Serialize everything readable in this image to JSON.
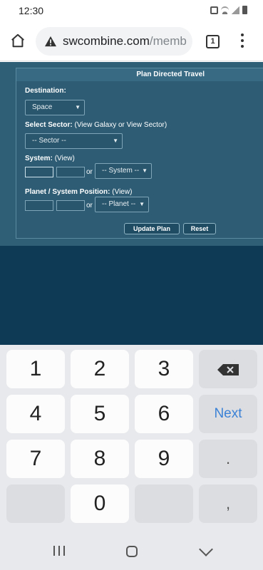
{
  "status_bar": {
    "time": "12:30"
  },
  "browser": {
    "url_host": "swcombine.com",
    "url_path": "/memb",
    "tab_count": "1"
  },
  "form": {
    "title": "Plan Directed Travel",
    "destination_label": "Destination:",
    "destination_value": "Space",
    "sector_label": "Select Sector:",
    "sector_links": "(View Galaxy or View Sector)",
    "sector_value": "-- Sector --",
    "system_label": "System:",
    "system_link": "(View)",
    "system_or": "or",
    "system_value": "-- System --",
    "planet_label": "Planet / System Position:",
    "planet_link": "(View)",
    "planet_or": "or",
    "planet_value": "-- Planet --",
    "update_button": "Update Plan",
    "reset_button": "Reset"
  },
  "keyboard": {
    "row1": [
      "1",
      "2",
      "3"
    ],
    "row2": [
      "4",
      "5",
      "6"
    ],
    "next_label": "Next",
    "row3": [
      "7",
      "8",
      "9"
    ],
    "dot": ".",
    "zero": "0",
    "comma": ","
  }
}
